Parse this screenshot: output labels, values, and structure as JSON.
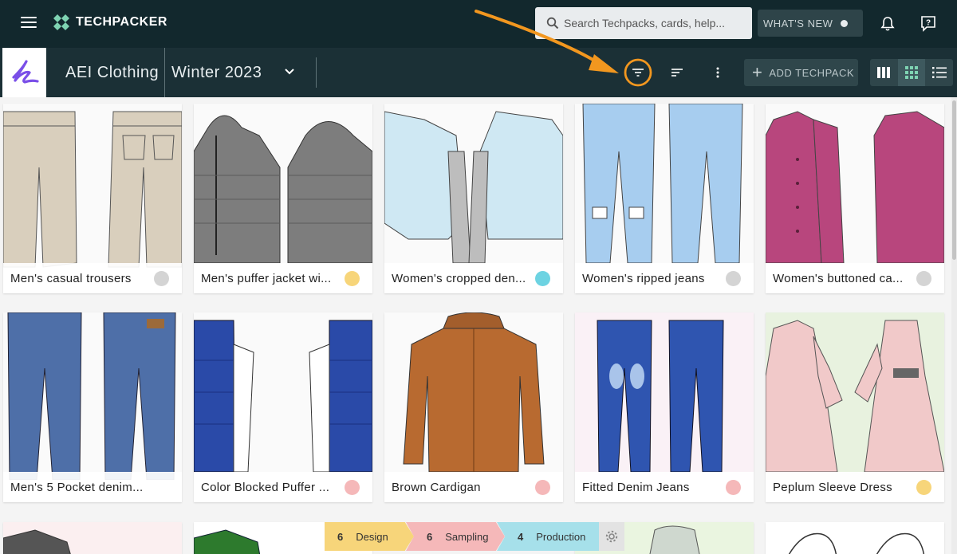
{
  "header": {
    "brand": "TECHPACKER",
    "search_placeholder": "Search Techpacks, cards, help...",
    "whats_new_label": "WHAT'S NEW"
  },
  "toolbar": {
    "workspace": "AEI Clothing",
    "season": "Winter 2023",
    "add_label": "ADD TECHPACK"
  },
  "colors": {
    "header_bg": "#12282d",
    "subbar_bg": "#1b3036",
    "accent_orange": "#f2971f",
    "status_grey": "#d4d4d4",
    "status_yellow": "#f7d57a",
    "status_cyan": "#6dd3e2",
    "status_pink": "#f5b8b9"
  },
  "cards": [
    {
      "title": "Men's casual trousers",
      "status": "grey"
    },
    {
      "title": "Men's puffer jacket wi...",
      "status": "yellow"
    },
    {
      "title": "Women's cropped den...",
      "status": "cyan"
    },
    {
      "title": "Women's ripped jeans",
      "status": "grey"
    },
    {
      "title": "Women's buttoned ca...",
      "status": "grey"
    },
    {
      "title": "Men's 5 Pocket denim...",
      "status": "none"
    },
    {
      "title": "Color Blocked Puffer ...",
      "status": "pink"
    },
    {
      "title": "Brown Cardigan",
      "status": "pink"
    },
    {
      "title": "Fitted Denim Jeans",
      "status": "pink"
    },
    {
      "title": "Peplum Sleeve Dress",
      "status": "yellow"
    }
  ],
  "pipeline": [
    {
      "count": "6",
      "label": "Design"
    },
    {
      "count": "6",
      "label": "Sampling"
    },
    {
      "count": "4",
      "label": "Production"
    }
  ],
  "icons": [
    "hamburger-icon",
    "logo-icon",
    "search-icon",
    "bell-icon",
    "help-icon",
    "chevron-down-icon",
    "filter-icon",
    "sort-icon",
    "more-vertical-icon",
    "plus-icon",
    "view-columns-icon",
    "view-grid-icon",
    "view-list-icon",
    "gear-icon"
  ]
}
